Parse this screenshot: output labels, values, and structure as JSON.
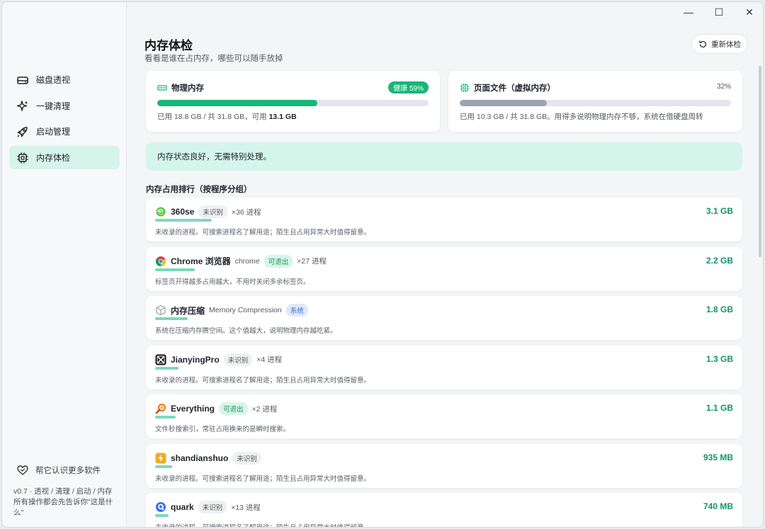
{
  "window": {
    "minimize": "—",
    "maximize": "☐",
    "close": "✕"
  },
  "sidebar": {
    "items": [
      {
        "label": "磁盘透视",
        "icon": "disk-icon"
      },
      {
        "label": "一键清理",
        "icon": "sparkle-icon"
      },
      {
        "label": "启动管理",
        "icon": "rocket-icon"
      },
      {
        "label": "内存体检",
        "icon": "chip-icon",
        "active": true
      }
    ],
    "footer_link": "帮它认识更多软件",
    "version_line1": "v0.7 · 透视 / 清理 / 启动 / 内存",
    "version_line2": "所有操作都会先告诉你\"这是什",
    "version_line3": "么\""
  },
  "header": {
    "title": "内存体检",
    "subtitle": "看看是谁在占内存，哪些可以随手放掉",
    "recheck_label": "重新体检"
  },
  "physical": {
    "title": "物理内存",
    "badge": "健康 59%",
    "used_fraction": 0.59,
    "info_prefix": "已用 18.8 GB / 共 31.8 GB，可用",
    "info_free": "13.1 GB",
    "fill_color": "#18b678"
  },
  "pagefile": {
    "title": "页面文件（虚拟内存）",
    "percent": "32%",
    "used_fraction": 0.32,
    "info": "已用 10.3 GB / 共 31.8 GB。用得多说明物理内存不够，系统在借硬盘周转",
    "fill_color": "#9aa3b0"
  },
  "status": "内存状态良好，无需特别处理。",
  "section_title": "内存占用排行（按程序分组）",
  "processes": [
    {
      "name": "360se",
      "sub": "",
      "tag": "未识别",
      "tag_type": "unk",
      "count": "×36 进程",
      "size": "3.1 GB",
      "bar": 1.0,
      "desc": "未收录的进程。可搜索进程名了解用途；陌生且占用异常大时值得留意。",
      "icon": "360se-icon"
    },
    {
      "name": "Chrome 浏览器",
      "sub": "chrome",
      "tag": "可退出",
      "tag_type": "exit",
      "count": "×27 进程",
      "size": "2.2 GB",
      "bar": 0.7,
      "desc": "标签页开得越多占用越大，不用时关闭多余标签页。",
      "icon": "chrome-icon"
    },
    {
      "name": "内存压缩",
      "sub": "Memory Compression",
      "tag": "系统",
      "tag_type": "sys",
      "count": "",
      "size": "1.8 GB",
      "bar": 0.57,
      "desc": "系统在压缩内存腾空间。这个值越大，说明物理内存越吃紧。",
      "icon": "cube-icon"
    },
    {
      "name": "JianyingPro",
      "sub": "",
      "tag": "未识别",
      "tag_type": "unk",
      "count": "×4 进程",
      "size": "1.3 GB",
      "bar": 0.41,
      "desc": "未收录的进程。可搜索进程名了解用途；陌生且占用异常大时值得留意。",
      "icon": "jianying-icon"
    },
    {
      "name": "Everything",
      "sub": "",
      "tag": "可退出",
      "tag_type": "exit",
      "count": "×2 进程",
      "size": "1.1 GB",
      "bar": 0.36,
      "desc": "文件秒搜索引，常驻占用换来的是瞬时搜索。",
      "icon": "everything-icon"
    },
    {
      "name": "shandianshuo",
      "sub": "",
      "tag": "未识别",
      "tag_type": "unk",
      "count": "",
      "size": "935 MB",
      "bar": 0.3,
      "desc": "未收录的进程。可搜索进程名了解用途；陌生且占用异常大时值得留意。",
      "icon": "lightning-icon"
    },
    {
      "name": "quark",
      "sub": "",
      "tag": "未识别",
      "tag_type": "unk",
      "count": "×13 进程",
      "size": "740 MB",
      "bar": 0.24,
      "desc": "未收录的进程。可搜索进程名了解用途；陌生且占用异常大时值得留意。",
      "icon": "quark-icon"
    }
  ]
}
